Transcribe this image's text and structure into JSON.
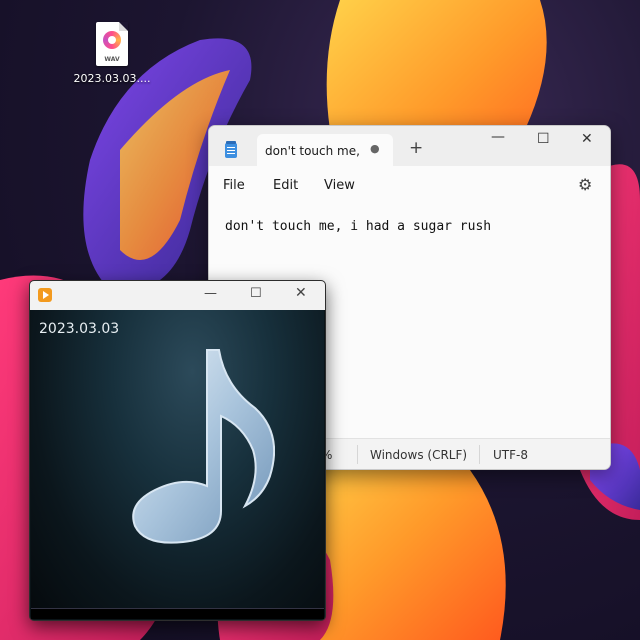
{
  "desktop": {
    "file_icon": {
      "icon": "wav-file-icon",
      "badge": "WAV",
      "label": "2023.03.03...."
    }
  },
  "notepad": {
    "app_icon": "notepad-icon",
    "tab_title": "don't touch me,",
    "tab_status": "●",
    "new_tab": "+",
    "window_controls": {
      "minimize": "—",
      "maximize": "☐",
      "close": "✕"
    },
    "menu": [
      "File",
      "Edit",
      "View"
    ],
    "settings_icon": "⚙",
    "content": "don't touch me, i had a sugar rush",
    "status": {
      "zoom": "%",
      "line_ending": "Windows (CRLF)",
      "encoding": "UTF-8"
    }
  },
  "player": {
    "app_icon": "media-player-icon",
    "window_controls": {
      "minimize": "—",
      "maximize": "☐",
      "close": "✕"
    },
    "title": "2023.03.03",
    "art_icon": "music-note-icon"
  }
}
